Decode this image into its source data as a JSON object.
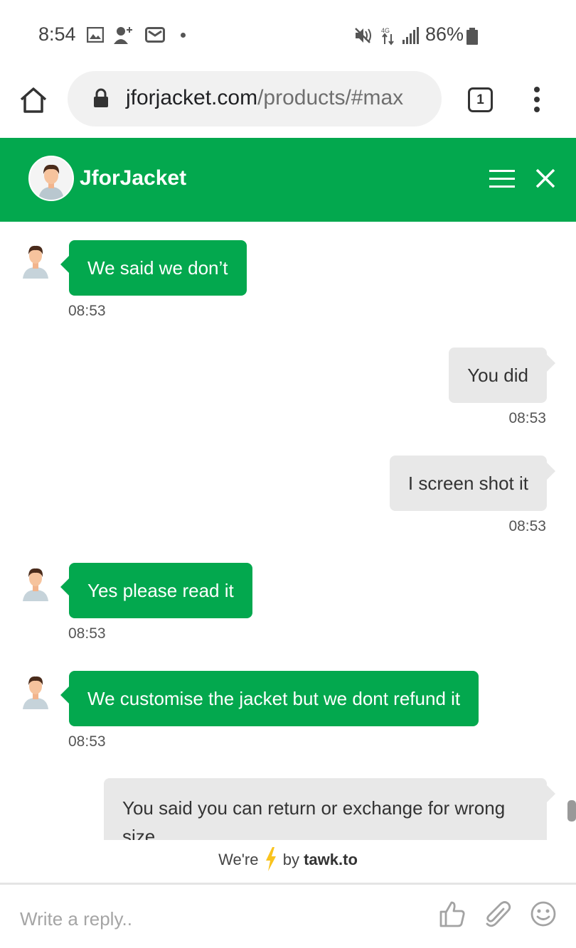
{
  "status_bar": {
    "time": "8:54",
    "battery": "86%"
  },
  "browser": {
    "url_host": "jforjacket.com",
    "url_path": "/products/#max",
    "tab_count": "1"
  },
  "chat": {
    "title": "JforJacket",
    "accent_color": "#03a84e",
    "messages": [
      {
        "sender": "agent",
        "text": "We said we don’t",
        "time": "08:53"
      },
      {
        "sender": "visitor",
        "text": "You did",
        "time": "08:53"
      },
      {
        "sender": "visitor",
        "text": "I screen shot it",
        "time": "08:53"
      },
      {
        "sender": "agent",
        "text": "Yes please read it",
        "time": "08:53"
      },
      {
        "sender": "agent",
        "text": "We customise the jacket but we dont refund it",
        "time": "08:53"
      },
      {
        "sender": "visitor",
        "text": "You said you can return or exchange for wrong size"
      }
    ]
  },
  "footer": {
    "powered_prefix": "We're",
    "powered_by": "by",
    "powered_brand": "tawk.to",
    "reply_placeholder": "Write a reply.."
  }
}
